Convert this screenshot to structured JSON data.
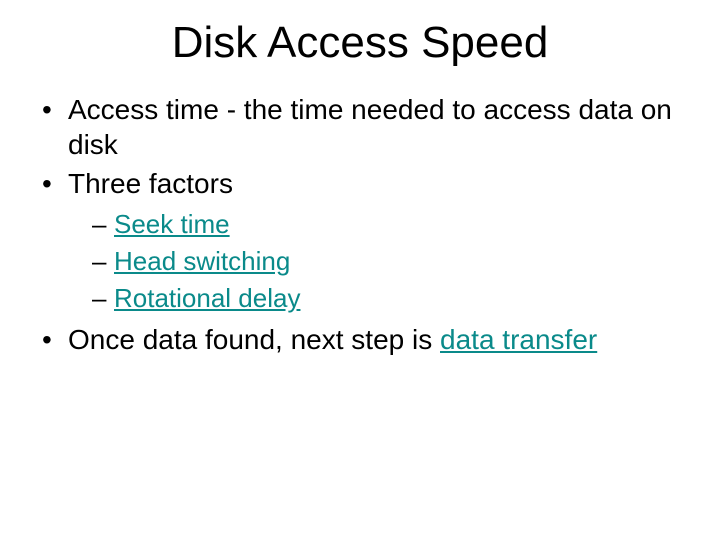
{
  "title": "Disk Access Speed",
  "bullets": {
    "b1": "Access time - the time needed to access data on disk",
    "b2": "Three factors",
    "sub": {
      "s1": "Seek time",
      "s2": "Head switching",
      "s3": "Rotational delay"
    },
    "b3_pre": "Once data found, next step is ",
    "b3_link": "data transfer"
  }
}
